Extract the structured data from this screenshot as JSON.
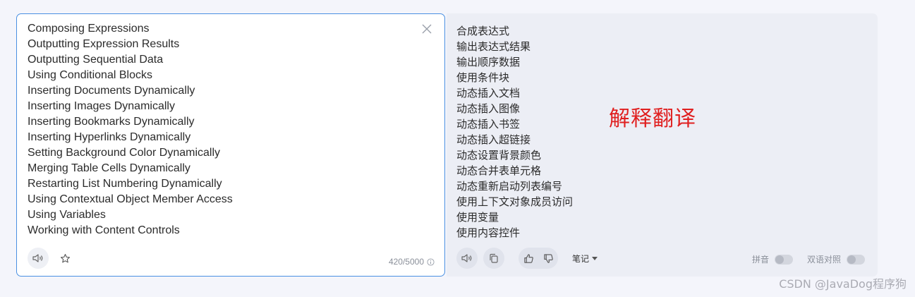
{
  "source": {
    "lines": [
      "Composing Expressions",
      "Outputting Expression Results",
      "Outputting Sequential Data",
      "Using Conditional Blocks",
      "Inserting Documents Dynamically",
      "Inserting Images Dynamically",
      "Inserting Bookmarks Dynamically",
      "Inserting Hyperlinks Dynamically",
      "Setting Background Color Dynamically",
      "Merging Table Cells Dynamically",
      "Restarting List Numbering Dynamically",
      "Using Contextual Object Member Access",
      "Using Variables",
      "Working with Content Controls"
    ],
    "char_count": "420/5000",
    "icons": {
      "clear": "close-icon",
      "speak": "speaker-icon",
      "favorite": "star-icon",
      "info": "info-icon"
    }
  },
  "target": {
    "lines": [
      "合成表达式",
      "输出表达式结果",
      "输出顺序数据",
      "使用条件块",
      "动态插入文档",
      "动态插入图像",
      "动态插入书签",
      "动态插入超链接",
      "动态设置背景颜色",
      "动态合并表单元格",
      "动态重新启动列表编号",
      "使用上下文对象成员访问",
      "使用变量",
      "使用内容控件"
    ],
    "annotation": "解释翻译",
    "notes_label": "笔记",
    "pinyin_label": "拼音",
    "bilingual_label": "双语对照",
    "icons": {
      "speak": "speaker-icon",
      "copy": "copy-icon",
      "like": "thumbs-up-icon",
      "dislike": "thumbs-down-icon",
      "notes_menu": "chevron-down-icon"
    }
  },
  "watermark": "CSDN @JavaDog程序狗",
  "colors": {
    "accent_border": "#4a90e2",
    "annotation": "#e02020",
    "page_bg": "#f4f5fb",
    "target_bg": "#eceef5"
  }
}
